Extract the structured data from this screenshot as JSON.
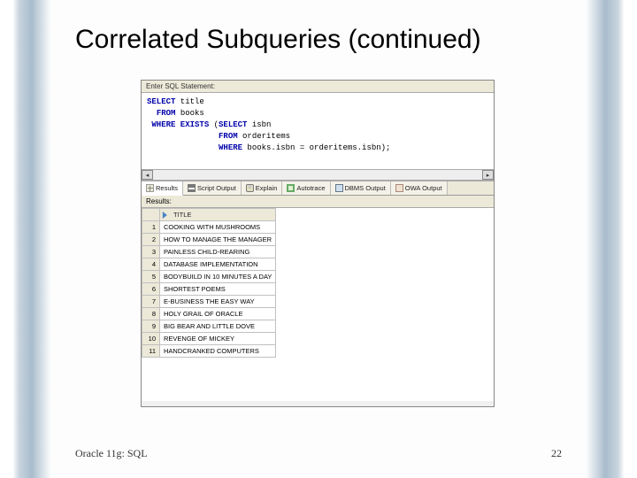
{
  "slide": {
    "title": "Correlated Subqueries (continued)",
    "footer_left": "Oracle 11g: SQL",
    "page_number": "22"
  },
  "sql_panel": {
    "label": "Enter SQL Statement:",
    "code": {
      "l1_kw": "SELECT",
      "l1_rest": " title",
      "l2_kw": "FROM",
      "l2_rest": " books",
      "l3_kw1": "WHERE EXISTS",
      "l3_mid": " (",
      "l3_kw2": "SELECT",
      "l3_rest": " isbn",
      "l4_kw": "FROM",
      "l4_rest": " orderitems",
      "l5_kw": "WHERE",
      "l5_rest": " books.isbn = orderitems.isbn);"
    }
  },
  "tabs": {
    "results": "Results",
    "script_output": "Script Output",
    "explain": "Explain",
    "autotrace": "Autotrace",
    "dbms_output": "DBMS Output",
    "owa_output": "OWA Output"
  },
  "results": {
    "label": "Results:",
    "column": "TITLE",
    "rows": [
      "COOKING WITH MUSHROOMS",
      "HOW TO MANAGE THE MANAGER",
      "PAINLESS CHILD-REARING",
      "DATABASE IMPLEMENTATION",
      "BODYBUILD IN 10 MINUTES A DAY",
      "SHORTEST POEMS",
      "E-BUSINESS THE EASY WAY",
      "HOLY GRAIL OF ORACLE",
      "BIG BEAR AND LITTLE DOVE",
      "REVENGE OF MICKEY",
      "HANDCRANKED COMPUTERS"
    ],
    "rownums": [
      "1",
      "2",
      "3",
      "4",
      "5",
      "6",
      "7",
      "8",
      "9",
      "10",
      "11"
    ]
  }
}
